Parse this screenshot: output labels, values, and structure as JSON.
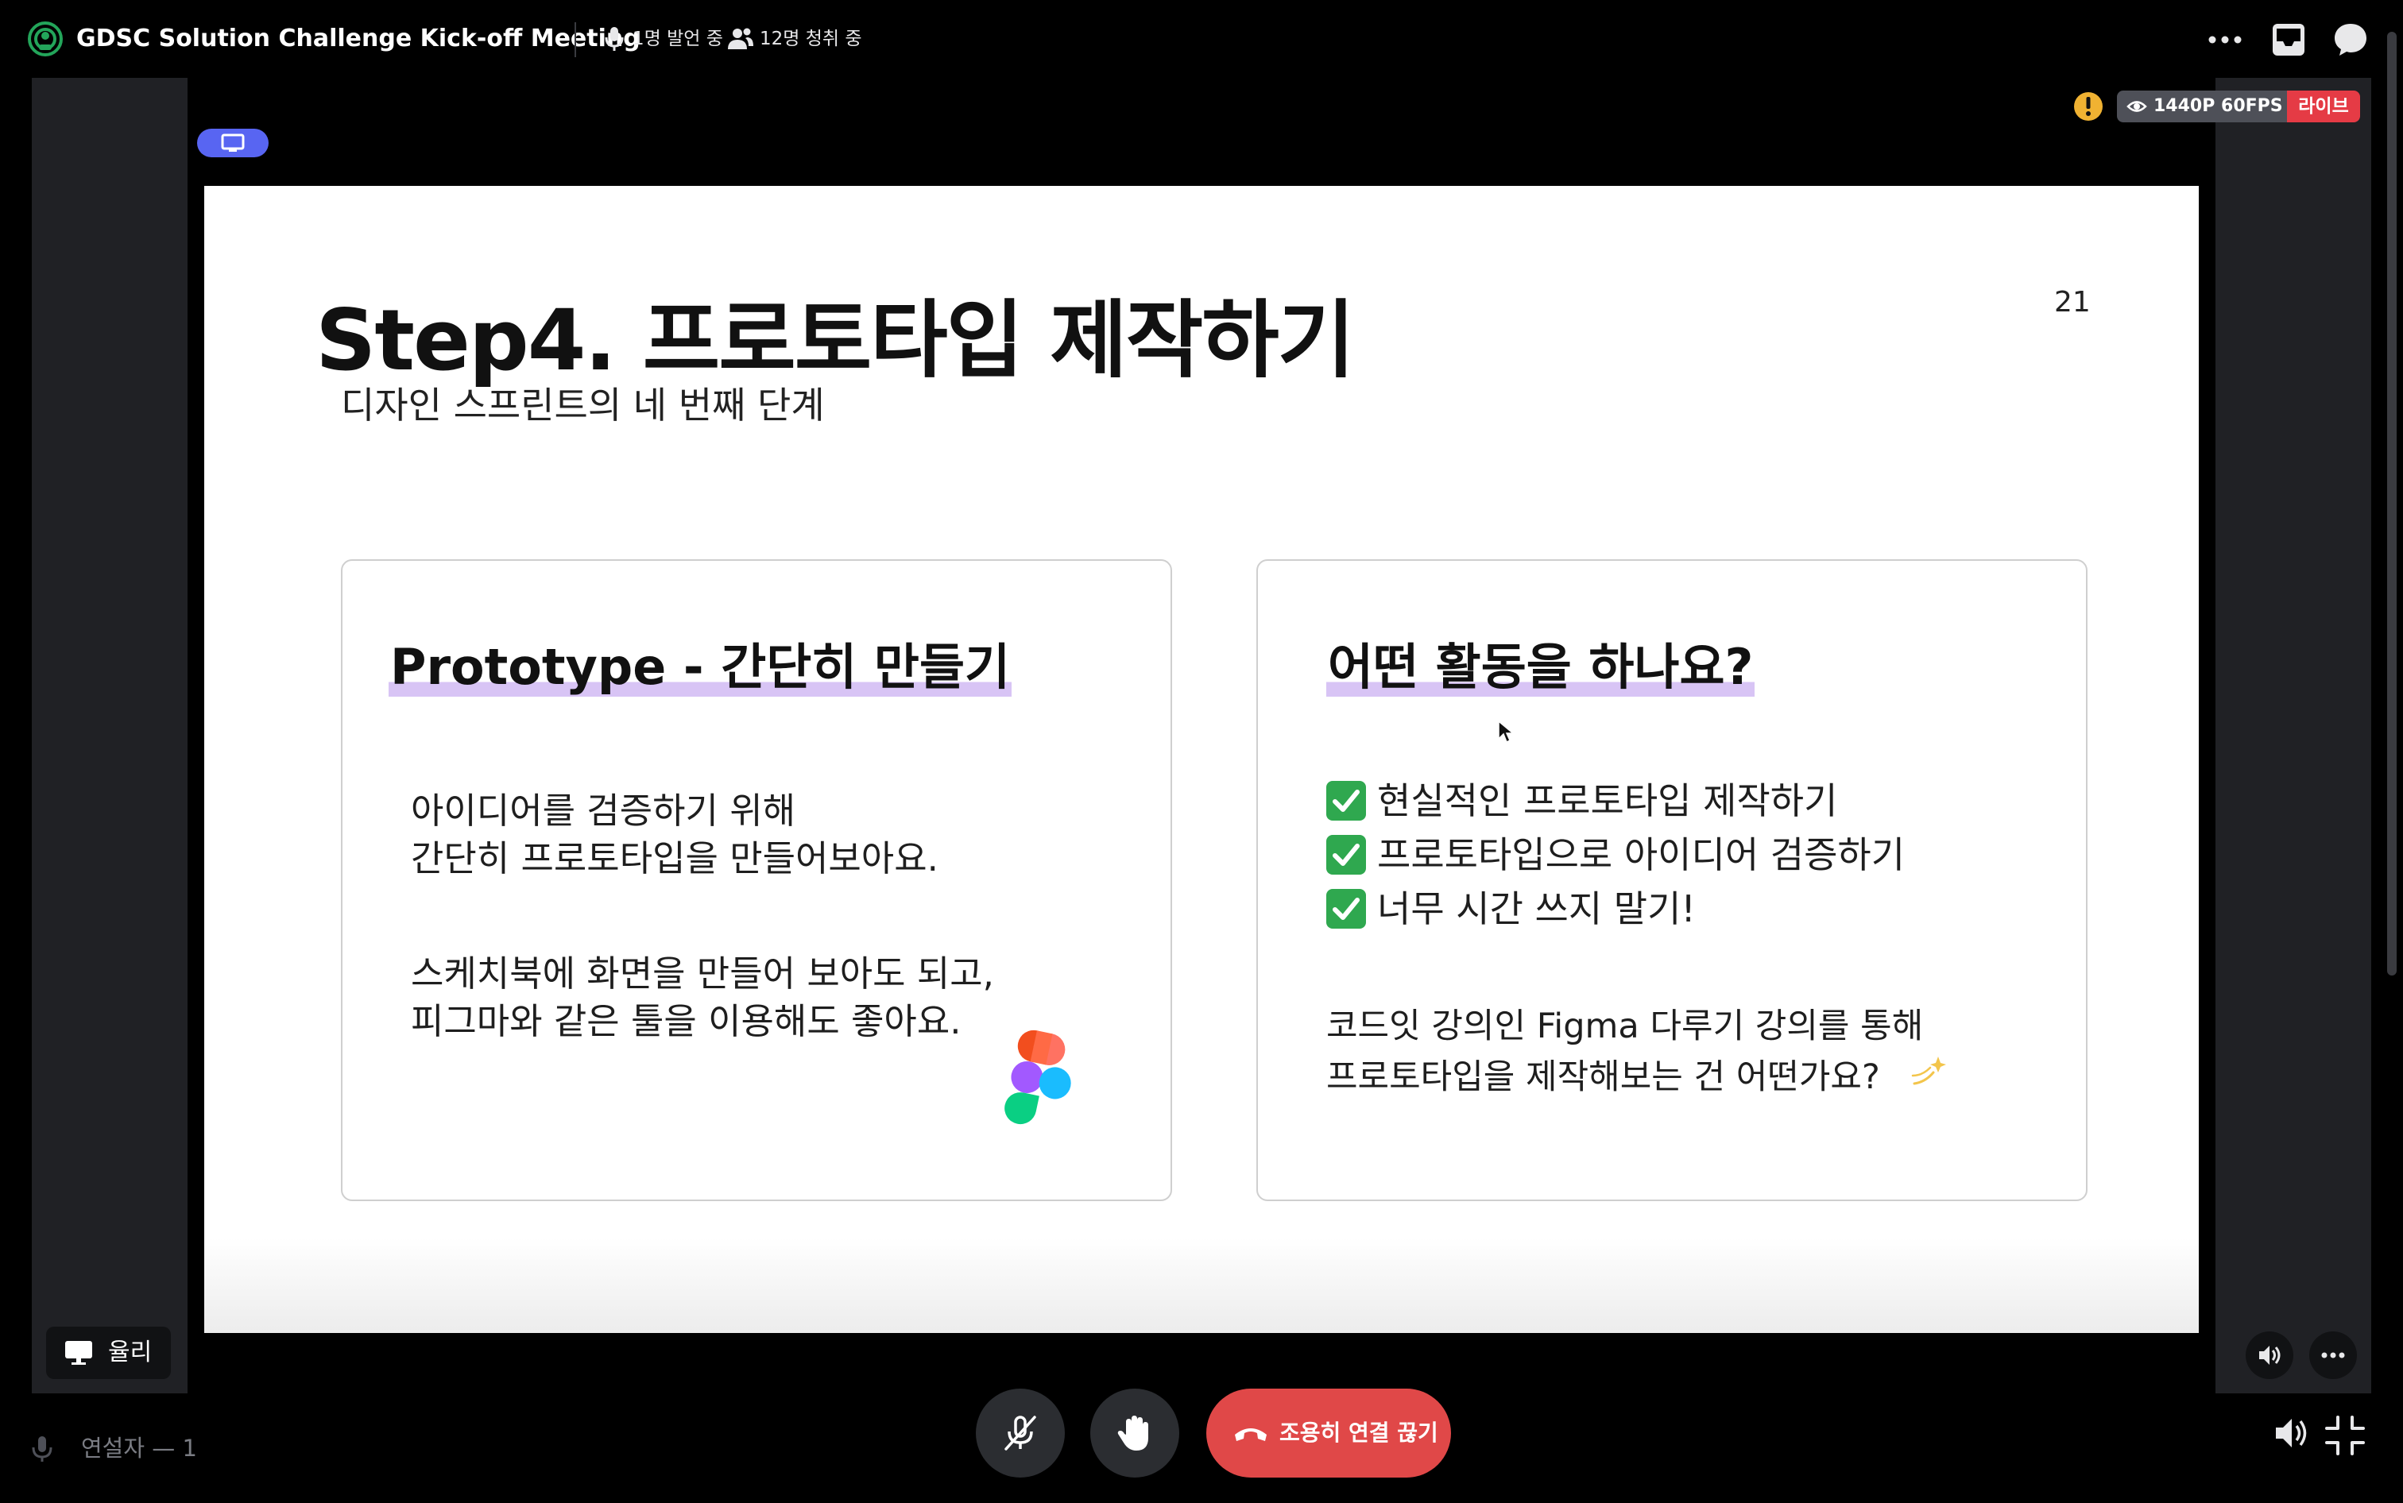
{
  "header": {
    "title": "GDSC Solution Challenge Kick-off Meeting",
    "speaker_count": "1명 발언 중",
    "listener_count": "12명 청취 중"
  },
  "stream": {
    "quality": "1440P 60FPS",
    "live_label": "라이브",
    "presenter_name": "율리",
    "warning_icon": "warning-icon",
    "accent_color": "#5865f2",
    "live_color": "#e53b45"
  },
  "slide": {
    "title": "Step4. 프로토타입 제작하기",
    "subtitle": "디자인 스프린트의 네 번째 단계",
    "page_number": "21",
    "left_card": {
      "heading": "Prototype - 간단히 만들기",
      "paragraph1_line1": "아이디어를 검증하기 위해",
      "paragraph1_line2": "간단히 프로토타입을 만들어보아요.",
      "paragraph2_line1": "스케치북에 화면을 만들어 보아도 되고,",
      "paragraph2_line2": "피그마와 같은 툴을 이용해도 좋아요."
    },
    "right_card": {
      "heading": "어떤 활동을 하나요?",
      "checklist": [
        "현실적인 프로토타입 제작하기",
        "프로토타입으로 아이디어 검증하기",
        "너무 시간 쓰지 말기!"
      ],
      "paragraph_line1": "코드잇 강의인 Figma 다루기 강의를 통해",
      "paragraph_line2": "프로토타입을 제작해보는 건 어떤가요?"
    }
  },
  "footer": {
    "speaker_section_label": "연설자 — 1",
    "disconnect_label": "조용히 연결 끊기",
    "disconnect_color": "#e04848"
  }
}
